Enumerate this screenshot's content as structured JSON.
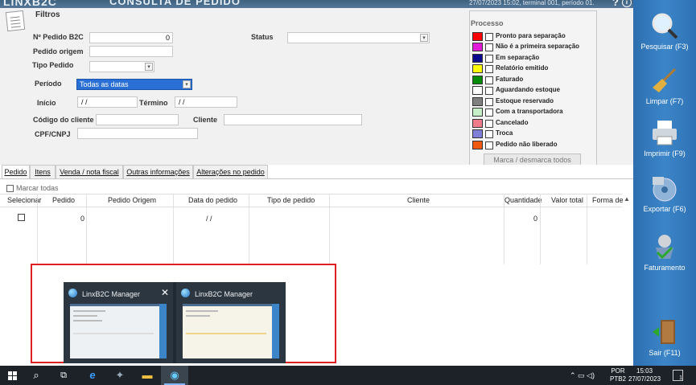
{
  "app": {
    "logo": "LINXB2C",
    "title": "CONSULTA DE PEDIDO",
    "status": "27/07/2023 15:02, terminal 001, período 01.",
    "help": "?",
    "info": "i"
  },
  "filters": {
    "title": "Filtros",
    "nro_pedido_label": "Nº Pedido B2C",
    "nro_pedido_value": "0",
    "pedido_origem_label": "Pedido origem",
    "tipo_pedido_label": "Tipo Pedido",
    "status_label": "Status",
    "periodo_label": "Período",
    "periodo_value": "Todas as datas",
    "inicio_label": "Início",
    "inicio_value": " / /",
    "termino_label": "Término",
    "termino_value": " / /",
    "codigo_label": "Código do cliente",
    "cliente_label": "Cliente",
    "cpf_label": "CPF/CNPJ"
  },
  "processo": {
    "title": "Processo",
    "items": [
      {
        "label": "Pronto para separação",
        "color": "#ff0000"
      },
      {
        "label": "Não é a primeira separação",
        "color": "#e01ad8"
      },
      {
        "label": "Em separação",
        "color": "#0a0a8c"
      },
      {
        "label": "Relatório emitido",
        "color": "#ffff00"
      },
      {
        "label": "Faturado",
        "color": "#078a07"
      },
      {
        "label": "Aguardando estoque",
        "color": "#ffffff"
      },
      {
        "label": "Estoque reservado",
        "color": "#7f7f7f"
      },
      {
        "label": "Com a transportadora",
        "color": "#c8f0c8"
      },
      {
        "label": "Cancelado",
        "color": "#f07b8a"
      },
      {
        "label": "Troca",
        "color": "#7f7fd8"
      },
      {
        "label": "Pedido não liberado",
        "color": "#f05a10"
      }
    ],
    "marca_button": "Marca / desmarca todos"
  },
  "sidebar": [
    {
      "label": "Pesquisar (F3)",
      "icon": "magnifier-icon"
    },
    {
      "label": "Limpar (F7)",
      "icon": "broom-icon"
    },
    {
      "label": "Imprimir (F9)",
      "icon": "printer-icon"
    },
    {
      "label": "Exportar (F6)",
      "icon": "export-disc-icon"
    },
    {
      "label": "Faturamento",
      "icon": "invoice-icon"
    },
    {
      "label": "Sair (F11)",
      "icon": "exit-door-icon"
    }
  ],
  "tabs": [
    "Pedido",
    "Itens",
    "Venda / nota fiscal",
    "Outras informações",
    "Alterações no pedido"
  ],
  "grid": {
    "marcar_todas": "Marcar todas",
    "headers": [
      "Selecionar",
      "Pedido",
      "Pedido Origem",
      "Data do pedido",
      "Tipo de pedido",
      "Cliente",
      "Quantidade",
      "Valor total",
      "Forma de"
    ],
    "rows": [
      {
        "pedido": "0",
        "data": "/ /",
        "quantidade": "0"
      }
    ]
  },
  "preview": {
    "thumb1_title": "LinxB2C Manager",
    "thumb2_title": "LinxB2C Manager",
    "close": "✕"
  },
  "taskbar": {
    "lang1": "POR",
    "lang2": "PTB2",
    "time": "15:03",
    "date": "27/07/2023",
    "notif_count": "1"
  }
}
